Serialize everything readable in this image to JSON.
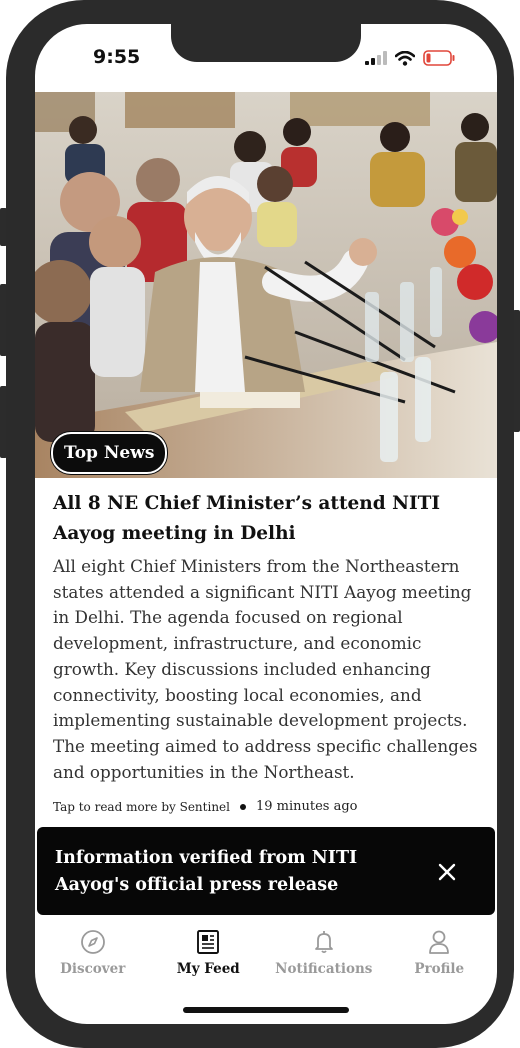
{
  "status_bar": {
    "time": "9:55"
  },
  "article": {
    "badge": "Top News",
    "headline": "All 8 NE Chief Minister’s attend NITI Aayog meeting in Delhi",
    "body": "All eight Chief Ministers from the Northeastern states attended a significant NITI Aayog meeting in Delhi. The agenda focused on regional development, infrastructure, and economic growth. Key discussions included enhancing connectivity, boosting local economies, and implementing sustainable development projects. The meeting aimed to address specific challenges and opportunities in the Northeast.",
    "source_text": "Tap to read more by Sentinel",
    "time_ago": "19 minutes ago"
  },
  "toast": {
    "message": "Information verified from NITI Aayog's official press release"
  },
  "nav": {
    "items": [
      {
        "label": "Discover",
        "icon": "compass-icon",
        "active": false
      },
      {
        "label": "My Feed",
        "icon": "newspaper-icon",
        "active": true
      },
      {
        "label": "Notifications",
        "icon": "bell-icon",
        "active": false
      },
      {
        "label": "Profile",
        "icon": "person-icon",
        "active": false
      }
    ]
  },
  "colors": {
    "accent": "#0c0c0c",
    "inactive": "#9a9a9a",
    "battery_low": "#e0463a"
  }
}
